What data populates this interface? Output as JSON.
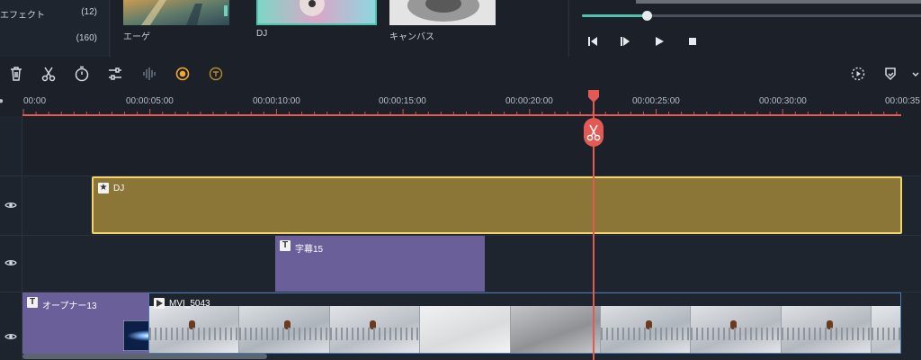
{
  "categories": [
    {
      "label": "エフェクト",
      "count": "(12)"
    },
    {
      "label": "",
      "count": "(160)"
    }
  ],
  "thumbnails": [
    {
      "label": "エーゲ"
    },
    {
      "label": "DJ"
    },
    {
      "label": "キャンバス"
    }
  ],
  "player": {
    "progress_fraction": 0.19
  },
  "ruler": {
    "ticks": [
      "00:00",
      "00:00:05:00",
      "00:00:10:00",
      "00:00:15:00",
      "00:00:20:00",
      "00:00:25:00",
      "00:00:30:00",
      "00:00:35"
    ]
  },
  "tracks": {
    "effect_clip": {
      "label": "DJ"
    },
    "title_clip": {
      "label": "字幕15"
    },
    "opener_clip": {
      "label": "オープナー13"
    },
    "video_clip": {
      "label": "MVI_5043"
    }
  },
  "colors": {
    "accent_teal": "#4fc3ae",
    "playhead": "#e35a54",
    "effect_clip": "#8b7537",
    "effect_clip_border": "#f2d36b",
    "title_clip": "#6a5f99"
  }
}
